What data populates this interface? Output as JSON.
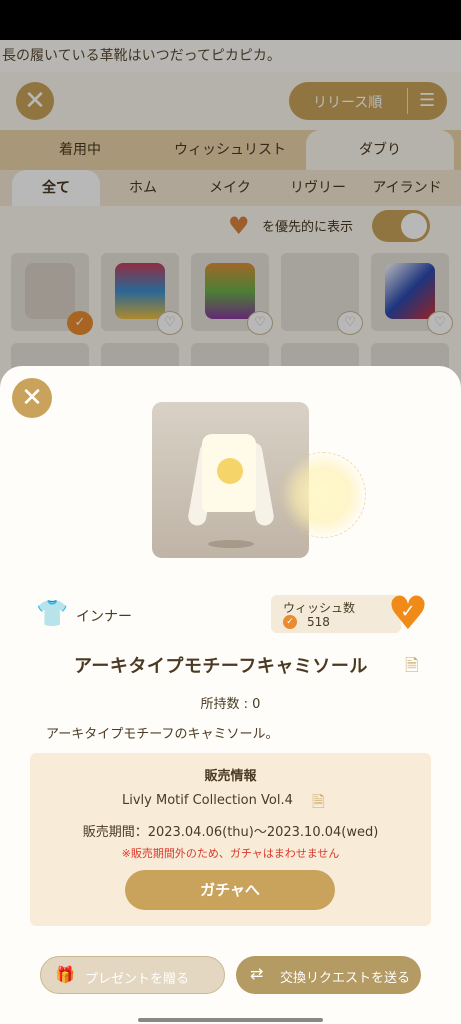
{
  "ticker": {
    "text": "長の履いている革靴はいつだってピカピカ。"
  },
  "header": {
    "sort_label": "リリース順"
  },
  "tabs": [
    {
      "label": "着用中"
    },
    {
      "label": "ウィッシュリスト"
    },
    {
      "label": "ダブり"
    }
  ],
  "subtabs": [
    {
      "label": "全て"
    },
    {
      "label": "ホム"
    },
    {
      "label": "メイク"
    },
    {
      "label": "リヴリー"
    },
    {
      "label": "アイランド"
    }
  ],
  "priority": {
    "label": "を優先的に表示",
    "enabled": true
  },
  "item": {
    "category": "インナー",
    "wish_label": "ウィッシュ数",
    "wish_count": "518",
    "name": "アーキタイプモチーフキャミソール",
    "owned": "所持数 : 0",
    "description": "アーキタイプモチーフのキャミソール。"
  },
  "sale": {
    "title": "販売情報",
    "collection": "Livly Motif Collection Vol.4",
    "period": "販売期間：2023.04.06(thu)〜2023.10.04(wed)",
    "note": "※販売期間外のため、ガチャはまわせません",
    "gacha_button": "ガチャへ"
  },
  "actions": {
    "gift_button": "プレゼントを贈る",
    "exchange_button": "交換リクエストを送る"
  },
  "colors": {
    "accent": "#c9a35b",
    "heart": "#f08a18",
    "warning": "#d93a2a"
  }
}
